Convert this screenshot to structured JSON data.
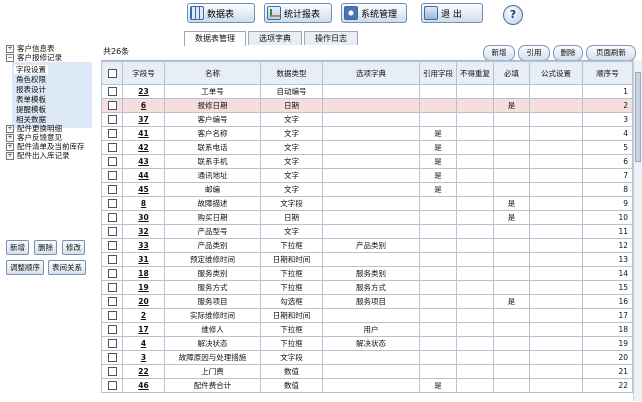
{
  "toolbar": {
    "data_table_label": "数据表",
    "stats_report_label": "统计报表",
    "system_admin_label": "系统管理",
    "exit_label": "退 出",
    "help_label": "?"
  },
  "tabs": [
    "数据表管理",
    "选项字典",
    "操作日志"
  ],
  "sidebar": {
    "tree": [
      {
        "label": "客户信息表",
        "expanded": false
      },
      {
        "label": "客户报修记录",
        "expanded": true
      },
      {
        "label": "配件更换明细",
        "expanded": false
      },
      {
        "label": "客户反馈意见",
        "expanded": false
      },
      {
        "label": "配件清单及当前库存",
        "expanded": false
      },
      {
        "label": "配件出入库记录",
        "expanded": false
      }
    ],
    "subitems": [
      "字段设置",
      "角色权限",
      "报表设计",
      "表单模板",
      "提醒模板",
      "相关数据"
    ],
    "buttons": {
      "add": "新增",
      "delete": "删除",
      "edit": "修改",
      "reorder": "调整顺序",
      "relation": "表间关系"
    }
  },
  "main": {
    "count_text": "共26条",
    "actions": {
      "add": "新增",
      "ref": "引用",
      "delete": "删除",
      "refresh": "页面刷新"
    },
    "columns": [
      "字段号",
      "名称",
      "数据类型",
      "选项字典",
      "引用字段",
      "不得重复",
      "必填",
      "公式设置",
      "顺序号"
    ],
    "rows": [
      {
        "no": "23",
        "name": "工单号",
        "type": "自动编号",
        "dict": "",
        "ref": "",
        "unique": "",
        "req": "",
        "formula": "",
        "seq": "1"
      },
      {
        "no": "6",
        "name": "报修日期",
        "type": "日期",
        "dict": "",
        "ref": "",
        "unique": "",
        "req": "是",
        "formula": "",
        "seq": "2"
      },
      {
        "no": "37",
        "name": "客户编号",
        "type": "文字",
        "dict": "",
        "ref": "",
        "unique": "",
        "req": "",
        "formula": "",
        "seq": "3"
      },
      {
        "no": "41",
        "name": "客户名称",
        "type": "文字",
        "dict": "",
        "ref": "是",
        "unique": "",
        "req": "",
        "formula": "",
        "seq": "4"
      },
      {
        "no": "42",
        "name": "联系电话",
        "type": "文字",
        "dict": "",
        "ref": "是",
        "unique": "",
        "req": "",
        "formula": "",
        "seq": "5"
      },
      {
        "no": "43",
        "name": "联系手机",
        "type": "文字",
        "dict": "",
        "ref": "是",
        "unique": "",
        "req": "",
        "formula": "",
        "seq": "6"
      },
      {
        "no": "44",
        "name": "通讯地址",
        "type": "文字",
        "dict": "",
        "ref": "是",
        "unique": "",
        "req": "",
        "formula": "",
        "seq": "7"
      },
      {
        "no": "45",
        "name": "邮编",
        "type": "文字",
        "dict": "",
        "ref": "是",
        "unique": "",
        "req": "",
        "formula": "",
        "seq": "8"
      },
      {
        "no": "8",
        "name": "故障描述",
        "type": "文字段",
        "dict": "",
        "ref": "",
        "unique": "",
        "req": "是",
        "formula": "",
        "seq": "9"
      },
      {
        "no": "30",
        "name": "购买日期",
        "type": "日期",
        "dict": "",
        "ref": "",
        "unique": "",
        "req": "是",
        "formula": "",
        "seq": "10"
      },
      {
        "no": "32",
        "name": "产品型号",
        "type": "文字",
        "dict": "",
        "ref": "",
        "unique": "",
        "req": "",
        "formula": "",
        "seq": "11"
      },
      {
        "no": "33",
        "name": "产品类别",
        "type": "下拉框",
        "dict": "产品类别",
        "ref": "",
        "unique": "",
        "req": "",
        "formula": "",
        "seq": "12"
      },
      {
        "no": "31",
        "name": "预定维修时间",
        "type": "日期和时间",
        "dict": "",
        "ref": "",
        "unique": "",
        "req": "",
        "formula": "",
        "seq": "13"
      },
      {
        "no": "18",
        "name": "服务类别",
        "type": "下拉框",
        "dict": "服务类别",
        "ref": "",
        "unique": "",
        "req": "",
        "formula": "",
        "seq": "14"
      },
      {
        "no": "19",
        "name": "服务方式",
        "type": "下拉框",
        "dict": "服务方式",
        "ref": "",
        "unique": "",
        "req": "",
        "formula": "",
        "seq": "15"
      },
      {
        "no": "20",
        "name": "服务项目",
        "type": "勾选框",
        "dict": "服务项目",
        "ref": "",
        "unique": "",
        "req": "是",
        "formula": "",
        "seq": "16"
      },
      {
        "no": "2",
        "name": "实际维修时间",
        "type": "日期和时间",
        "dict": "",
        "ref": "",
        "unique": "",
        "req": "",
        "formula": "",
        "seq": "17"
      },
      {
        "no": "17",
        "name": "维修人",
        "type": "下拉框",
        "dict": "用户",
        "ref": "",
        "unique": "",
        "req": "",
        "formula": "",
        "seq": "18"
      },
      {
        "no": "4",
        "name": "解决状态",
        "type": "下拉框",
        "dict": "解决状态",
        "ref": "",
        "unique": "",
        "req": "",
        "formula": "",
        "seq": "19"
      },
      {
        "no": "3",
        "name": "故障原因与处理措施",
        "type": "文字段",
        "dict": "",
        "ref": "",
        "unique": "",
        "req": "",
        "formula": "",
        "seq": "20"
      },
      {
        "no": "22",
        "name": "上门费",
        "type": "数值",
        "dict": "",
        "ref": "",
        "unique": "",
        "req": "",
        "formula": "",
        "seq": "21"
      },
      {
        "no": "46",
        "name": "配件费合计",
        "type": "数值",
        "dict": "",
        "ref": "是",
        "unique": "",
        "req": "",
        "formula": "",
        "seq": "22"
      }
    ]
  }
}
